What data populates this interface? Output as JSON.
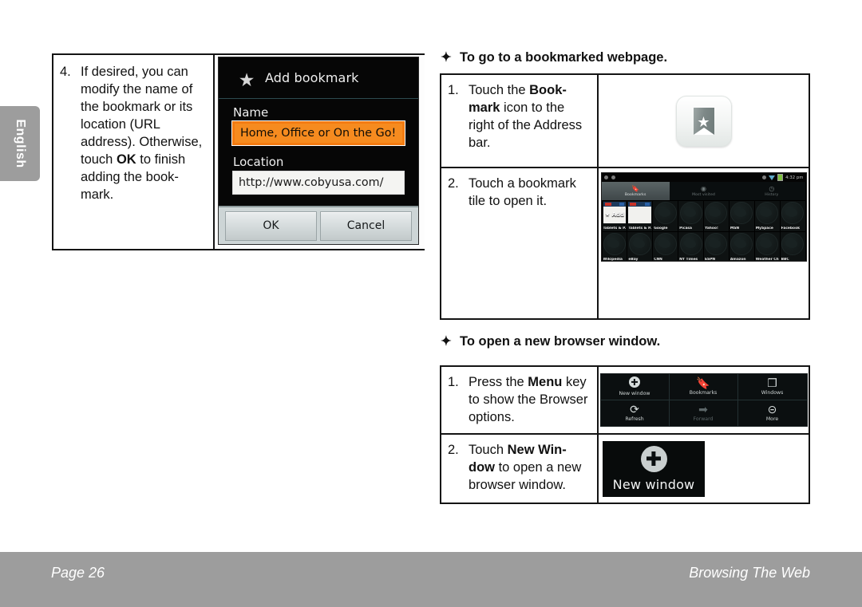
{
  "page": {
    "language_tab": "English",
    "footer_page": "Page 26",
    "footer_section": "Browsing The Web",
    "accent_orange": "#f68b1f",
    "footer_gray": "#9d9d9d"
  },
  "step4": {
    "number": "4.",
    "text_parts": {
      "a": "If desired, you can modify the name of the bookmark or its location (URL address). Otherwise, touch ",
      "b": "OK",
      "c": " to finish adding the book-mark."
    },
    "full_text": "If desired, you can modify the name of the bookmark or its location (URL address). Otherwise, touch OK to finish adding the bookmark."
  },
  "add_bookmark_dialog": {
    "title": "Add bookmark",
    "star_icon": "star-icon",
    "name_label": "Name",
    "name_value": "Home, Office or On the Go!",
    "location_label": "Location",
    "location_value": "http://www.cobyusa.com/",
    "ok_label": "OK",
    "cancel_label": "Cancel"
  },
  "section_bookmarked": {
    "bullet": "✦",
    "title": "To go to a bookmarked webpage.",
    "rows": [
      {
        "number": "1.",
        "text_a": "Touch the ",
        "text_b": "Book-mark",
        "text_c": " icon to the right of the Address bar."
      },
      {
        "number": "2.",
        "text_a": "Touch a bookmark tile to open it.",
        "text_b": "",
        "text_c": ""
      }
    ]
  },
  "bookmark_button": {
    "icon": "bookmark-ribbon-star-icon"
  },
  "bookmarks_screen": {
    "status_time": "4:32 pm",
    "tabs": [
      {
        "label": "Bookmarks",
        "icon": "bookmark-icon",
        "active": true
      },
      {
        "label": "Most visited",
        "icon": "eye-icon",
        "active": false
      },
      {
        "label": "History",
        "icon": "clock-icon",
        "active": false
      }
    ],
    "add_label": "Add",
    "tiles": [
      "Tablets & P..",
      "Tablets & P..",
      "Google",
      "Picasa",
      "Yahoo!",
      "MSN",
      "MySpace",
      "Facebook",
      "Wikipedia",
      "eBay",
      "CNN",
      "NY Times",
      "ESPN",
      "Amazon",
      "Weather Ch.",
      "BBC"
    ]
  },
  "section_newwindow": {
    "bullet": "✦",
    "title": "To open a new browser window.",
    "rows": [
      {
        "number": "1.",
        "text_a": "Press the ",
        "text_b": "Menu",
        "text_c": " key to show the Browser options."
      },
      {
        "number": "2.",
        "text_a": "Touch ",
        "text_b": "New Win-dow",
        "text_c": " to open a new browser window."
      }
    ]
  },
  "browser_options_menu": {
    "items": [
      {
        "label": "New window",
        "icon": "plus-circle-icon",
        "dimmed": false
      },
      {
        "label": "Bookmarks",
        "icon": "bookmark-icon",
        "dimmed": false
      },
      {
        "label": "Windows",
        "icon": "windows-icon",
        "dimmed": false
      },
      {
        "label": "Refresh",
        "icon": "refresh-icon",
        "dimmed": false
      },
      {
        "label": "Forward",
        "icon": "arrow-right-icon",
        "dimmed": true
      },
      {
        "label": "More",
        "icon": "chevron-down-circle-icon",
        "dimmed": false
      }
    ]
  },
  "new_window_tile": {
    "label": "New window",
    "icon": "plus-circle-icon"
  }
}
